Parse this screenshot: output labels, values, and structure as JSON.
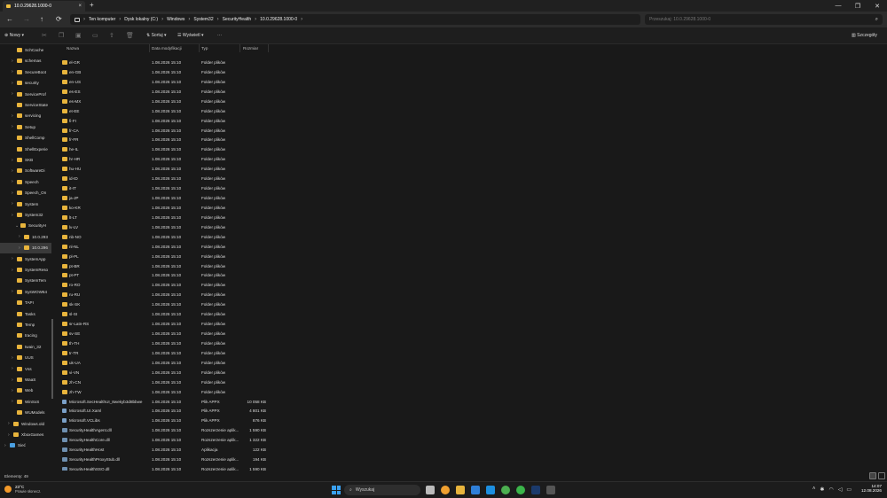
{
  "window": {
    "tab_title": "10.0.29628.1000-0",
    "tab_close": "×",
    "new_tab": "+"
  },
  "nav": {
    "back": "←",
    "forward": "→",
    "up": "↑",
    "refresh": "⟳"
  },
  "address": {
    "crumbs": [
      "Ten komputer",
      "Dysk lokalny (C:)",
      "Windows",
      "System32",
      "SecurityHealth",
      "10.0.29628.1000-0"
    ]
  },
  "search": {
    "placeholder": "Przeszukaj: 10.0.29628.1000-0"
  },
  "toolbar": {
    "new_label": "Nowy",
    "sort_label": "Sortuj",
    "view_label": "Wyświetl",
    "more_label": "···",
    "details_label": "Szczegóły"
  },
  "columns": {
    "name": "Nazwa",
    "date": "Data modyfikacji",
    "type": "Typ",
    "size": "Rozmiar"
  },
  "sidebar": {
    "items": [
      {
        "label": "SchCache",
        "exp": "",
        "indent": 0
      },
      {
        "label": "schemas",
        "exp": ">",
        "indent": 0
      },
      {
        "label": "SecureBoot",
        "exp": ">",
        "indent": 0
      },
      {
        "label": "security",
        "exp": ">",
        "indent": 0
      },
      {
        "label": "ServiceProf",
        "exp": ">",
        "indent": 0
      },
      {
        "label": "ServiceState",
        "exp": "",
        "indent": 0
      },
      {
        "label": "servicing",
        "exp": ">",
        "indent": 0
      },
      {
        "label": "Setup",
        "exp": ">",
        "indent": 0
      },
      {
        "label": "ShellComp",
        "exp": "",
        "indent": 0
      },
      {
        "label": "ShellExperie",
        "exp": "",
        "indent": 0
      },
      {
        "label": "SKB",
        "exp": ">",
        "indent": 0
      },
      {
        "label": "SoftwareDi",
        "exp": ">",
        "indent": 0
      },
      {
        "label": "Speech",
        "exp": ">",
        "indent": 0
      },
      {
        "label": "Speech_On",
        "exp": ">",
        "indent": 0
      },
      {
        "label": "System",
        "exp": ">",
        "indent": 0
      },
      {
        "label": "System32",
        "exp": ">",
        "indent": 0
      },
      {
        "label": "SecurityH",
        "exp": "v",
        "indent": 1
      },
      {
        "label": "10.0.293",
        "exp": ">",
        "indent": 2
      },
      {
        "label": "10.0.296",
        "exp": ">",
        "indent": 2,
        "selected": true
      },
      {
        "label": "SystemApp",
        "exp": ">",
        "indent": 0
      },
      {
        "label": "SystemReso",
        "exp": ">",
        "indent": 0
      },
      {
        "label": "SystemTem",
        "exp": "",
        "indent": 0
      },
      {
        "label": "SysWOW64",
        "exp": ">",
        "indent": 0
      },
      {
        "label": "TAPI",
        "exp": "",
        "indent": 0
      },
      {
        "label": "Tasks",
        "exp": "",
        "indent": 0
      },
      {
        "label": "Temp",
        "exp": "",
        "indent": 0
      },
      {
        "label": "tracing",
        "exp": "",
        "indent": 0
      },
      {
        "label": "twain_32",
        "exp": "",
        "indent": 0
      },
      {
        "label": "UUS",
        "exp": ">",
        "indent": 0
      },
      {
        "label": "Vss",
        "exp": ">",
        "indent": 0
      },
      {
        "label": "WaaS",
        "exp": ">",
        "indent": 0
      },
      {
        "label": "Web",
        "exp": ">",
        "indent": 0
      },
      {
        "label": "WinSxS",
        "exp": ">",
        "indent": 0
      },
      {
        "label": "WUModels",
        "exp": "",
        "indent": 0
      },
      {
        "label": "Windows.old",
        "exp": ">",
        "indent": -1
      },
      {
        "label": "XboxGames",
        "exp": ">",
        "indent": -1
      },
      {
        "label": "Sieć",
        "exp": ">",
        "indent": -2,
        "net": true
      }
    ]
  },
  "files": [
    {
      "name": "el-GR",
      "date": "1.08.2026 15:10",
      "type": "Folder plików",
      "size": "",
      "kind": "folder"
    },
    {
      "name": "en-GB",
      "date": "1.08.2026 15:10",
      "type": "Folder plików",
      "size": "",
      "kind": "folder"
    },
    {
      "name": "en-US",
      "date": "1.08.2026 15:10",
      "type": "Folder plików",
      "size": "",
      "kind": "folder"
    },
    {
      "name": "es-ES",
      "date": "1.08.2026 15:10",
      "type": "Folder plików",
      "size": "",
      "kind": "folder"
    },
    {
      "name": "es-MX",
      "date": "1.08.2026 15:10",
      "type": "Folder plików",
      "size": "",
      "kind": "folder"
    },
    {
      "name": "et-EE",
      "date": "1.08.2026 15:10",
      "type": "Folder plików",
      "size": "",
      "kind": "folder"
    },
    {
      "name": "fi-FI",
      "date": "1.08.2026 15:10",
      "type": "Folder plików",
      "size": "",
      "kind": "folder"
    },
    {
      "name": "fr-CA",
      "date": "1.08.2026 15:10",
      "type": "Folder plików",
      "size": "",
      "kind": "folder"
    },
    {
      "name": "fr-FR",
      "date": "1.08.2026 15:10",
      "type": "Folder plików",
      "size": "",
      "kind": "folder"
    },
    {
      "name": "he-IL",
      "date": "1.08.2026 15:10",
      "type": "Folder plików",
      "size": "",
      "kind": "folder"
    },
    {
      "name": "hr-HR",
      "date": "1.08.2026 15:10",
      "type": "Folder plików",
      "size": "",
      "kind": "folder"
    },
    {
      "name": "hu-HU",
      "date": "1.08.2026 15:10",
      "type": "Folder plików",
      "size": "",
      "kind": "folder"
    },
    {
      "name": "id-ID",
      "date": "1.08.2026 15:10",
      "type": "Folder plików",
      "size": "",
      "kind": "folder"
    },
    {
      "name": "it-IT",
      "date": "1.08.2026 15:10",
      "type": "Folder plików",
      "size": "",
      "kind": "folder"
    },
    {
      "name": "ja-JP",
      "date": "1.08.2026 15:10",
      "type": "Folder plików",
      "size": "",
      "kind": "folder"
    },
    {
      "name": "ko-KR",
      "date": "1.08.2026 15:10",
      "type": "Folder plików",
      "size": "",
      "kind": "folder"
    },
    {
      "name": "lt-LT",
      "date": "1.08.2026 15:10",
      "type": "Folder plików",
      "size": "",
      "kind": "folder"
    },
    {
      "name": "lv-LV",
      "date": "1.08.2026 15:10",
      "type": "Folder plików",
      "size": "",
      "kind": "folder"
    },
    {
      "name": "nb-NO",
      "date": "1.08.2026 15:10",
      "type": "Folder plików",
      "size": "",
      "kind": "folder"
    },
    {
      "name": "nl-NL",
      "date": "1.08.2026 15:10",
      "type": "Folder plików",
      "size": "",
      "kind": "folder"
    },
    {
      "name": "pl-PL",
      "date": "1.08.2026 15:10",
      "type": "Folder plików",
      "size": "",
      "kind": "folder"
    },
    {
      "name": "pt-BR",
      "date": "1.08.2026 15:10",
      "type": "Folder plików",
      "size": "",
      "kind": "folder"
    },
    {
      "name": "pt-PT",
      "date": "1.08.2026 15:10",
      "type": "Folder plików",
      "size": "",
      "kind": "folder"
    },
    {
      "name": "ro-RO",
      "date": "1.08.2026 15:10",
      "type": "Folder plików",
      "size": "",
      "kind": "folder"
    },
    {
      "name": "ru-RU",
      "date": "1.08.2026 15:10",
      "type": "Folder plików",
      "size": "",
      "kind": "folder"
    },
    {
      "name": "sk-SK",
      "date": "1.08.2026 15:10",
      "type": "Folder plików",
      "size": "",
      "kind": "folder"
    },
    {
      "name": "sl-SI",
      "date": "1.08.2026 15:10",
      "type": "Folder plików",
      "size": "",
      "kind": "folder"
    },
    {
      "name": "sr-Latn-RS",
      "date": "1.08.2026 15:10",
      "type": "Folder plików",
      "size": "",
      "kind": "folder"
    },
    {
      "name": "sv-SE",
      "date": "1.08.2026 15:10",
      "type": "Folder plików",
      "size": "",
      "kind": "folder"
    },
    {
      "name": "th-TH",
      "date": "1.08.2026 15:10",
      "type": "Folder plików",
      "size": "",
      "kind": "folder"
    },
    {
      "name": "tr-TR",
      "date": "1.08.2026 15:10",
      "type": "Folder plików",
      "size": "",
      "kind": "folder"
    },
    {
      "name": "uk-UA",
      "date": "1.08.2026 15:10",
      "type": "Folder plików",
      "size": "",
      "kind": "folder"
    },
    {
      "name": "vi-VN",
      "date": "1.08.2026 15:10",
      "type": "Folder plików",
      "size": "",
      "kind": "folder"
    },
    {
      "name": "zh-CN",
      "date": "1.08.2026 15:10",
      "type": "Folder plików",
      "size": "",
      "kind": "folder"
    },
    {
      "name": "zh-TW",
      "date": "1.08.2026 15:10",
      "type": "Folder plików",
      "size": "",
      "kind": "folder"
    },
    {
      "name": "Microsoft.SecHealthUI_8wekyb3d8bbwe",
      "date": "1.08.2026 15:10",
      "type": "Plik APPX",
      "size": "10 058 KB",
      "kind": "appx"
    },
    {
      "name": "Microsoft.UI.Xaml",
      "date": "1.08.2026 15:10",
      "type": "Plik APPX",
      "size": "4 801 KB",
      "kind": "appx"
    },
    {
      "name": "Microsoft.VCLibs",
      "date": "1.08.2026 15:10",
      "type": "Plik APPX",
      "size": "876 KB",
      "kind": "appx"
    },
    {
      "name": "SecurityHealthAgent.dll",
      "date": "1.08.2026 15:10",
      "type": "Rozszerzenie aplik...",
      "size": "1 590 KB",
      "kind": "file"
    },
    {
      "name": "SecurityHealthCore.dll",
      "date": "1.08.2026 15:10",
      "type": "Rozszerzenie aplik...",
      "size": "1 322 KB",
      "kind": "file"
    },
    {
      "name": "SecurityHealthHost",
      "date": "1.08.2026 15:10",
      "type": "Aplikacja",
      "size": "122 KB",
      "kind": "app"
    },
    {
      "name": "SecurityHealthProxyStub.dll",
      "date": "1.08.2026 15:10",
      "type": "Rozszerzenie aplik...",
      "size": "194 KB",
      "kind": "file"
    },
    {
      "name": "SecurityHealthSSO.dll",
      "date": "1.08.2026 15:10",
      "type": "Rozszerzenie aplik...",
      "size": "1 590 KB",
      "kind": "file"
    }
  ],
  "status": {
    "count": "Elementy: 49"
  },
  "taskbar": {
    "temp": "23°C",
    "weather": "Prawie słonecz.",
    "search": "Wyszukaj",
    "time": "14:07",
    "date": "12.08.2026"
  }
}
